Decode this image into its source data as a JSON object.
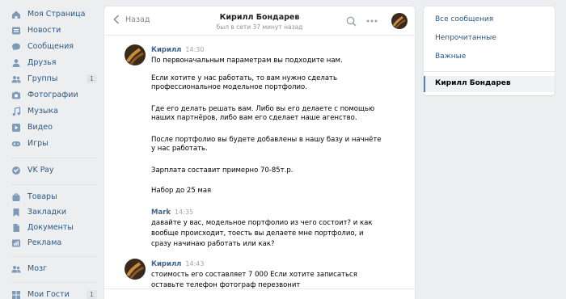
{
  "nav": {
    "items": [
      {
        "label": "Моя Страница",
        "icon": "home-icon"
      },
      {
        "label": "Новости",
        "icon": "news-icon"
      },
      {
        "label": "Сообщения",
        "icon": "messages-icon"
      },
      {
        "label": "Друзья",
        "icon": "friends-icon"
      },
      {
        "label": "Группы",
        "icon": "groups-icon",
        "count": "1"
      },
      {
        "label": "Фотографии",
        "icon": "photos-icon"
      },
      {
        "label": "Музыка",
        "icon": "music-icon"
      },
      {
        "label": "Видео",
        "icon": "video-icon"
      },
      {
        "label": "Игры",
        "icon": "games-icon"
      },
      {
        "label": "VK Pay",
        "icon": "vkpay-icon"
      },
      {
        "label": "Товары",
        "icon": "goods-icon"
      },
      {
        "label": "Закладки",
        "icon": "bookmarks-icon"
      },
      {
        "label": "Документы",
        "icon": "documents-icon"
      },
      {
        "label": "Реклама",
        "icon": "ads-icon"
      },
      {
        "label": "Мозг",
        "icon": "community-icon"
      },
      {
        "label": "Мои Гости",
        "icon": "guests-icon",
        "count": "1"
      }
    ]
  },
  "chat": {
    "back_label": "Назад",
    "peer_name": "Кирилл Бондарев",
    "peer_status": "был в сети 37 минут назад",
    "messages": [
      {
        "author": "Кирилл",
        "time": "14:30",
        "lines": [
          "По первоначальным параметрам вы подходите нам.",
          "",
          "Если хотите у нас работать, то вам нужно сделать",
          "профессиональное модельное портфолио.",
          "",
          "Где его делать решать вам. Либо вы его делаете с помощью",
          "наших партнёров, либо вам его сделает наше агенство.",
          "",
          "После портфолио вы будете добавлены в нашу базу и начнёте",
          "у нас работать.",
          "",
          "Зарплата составит примерно 70-85т.р.",
          "",
          "Набор до 25 мая"
        ]
      },
      {
        "author": "Mark",
        "time": "14:35",
        "lines": [
          "давайте у вас, модельное портфолио из чего состоит? и как",
          "вообще происходит, тоесть вы делаете мне портфолио, и",
          "сразу начинаю работать или как?"
        ]
      },
      {
        "author": "Кирилл",
        "time": "14:43",
        "lines": [
          "стоимость его составляет 7 000 Если хотите записаться",
          "оставьте телефон фотограф перезвонит"
        ]
      }
    ]
  },
  "right_panel": {
    "all_messages": "Все сообщения",
    "unread": "Непрочитанные",
    "important": "Важные",
    "active_dialog": "Кирилл Бондарев"
  },
  "colors": {
    "link": "#2a5885",
    "author": "#42648b",
    "background": "#edeef0",
    "active_marker": "#5181b8"
  }
}
